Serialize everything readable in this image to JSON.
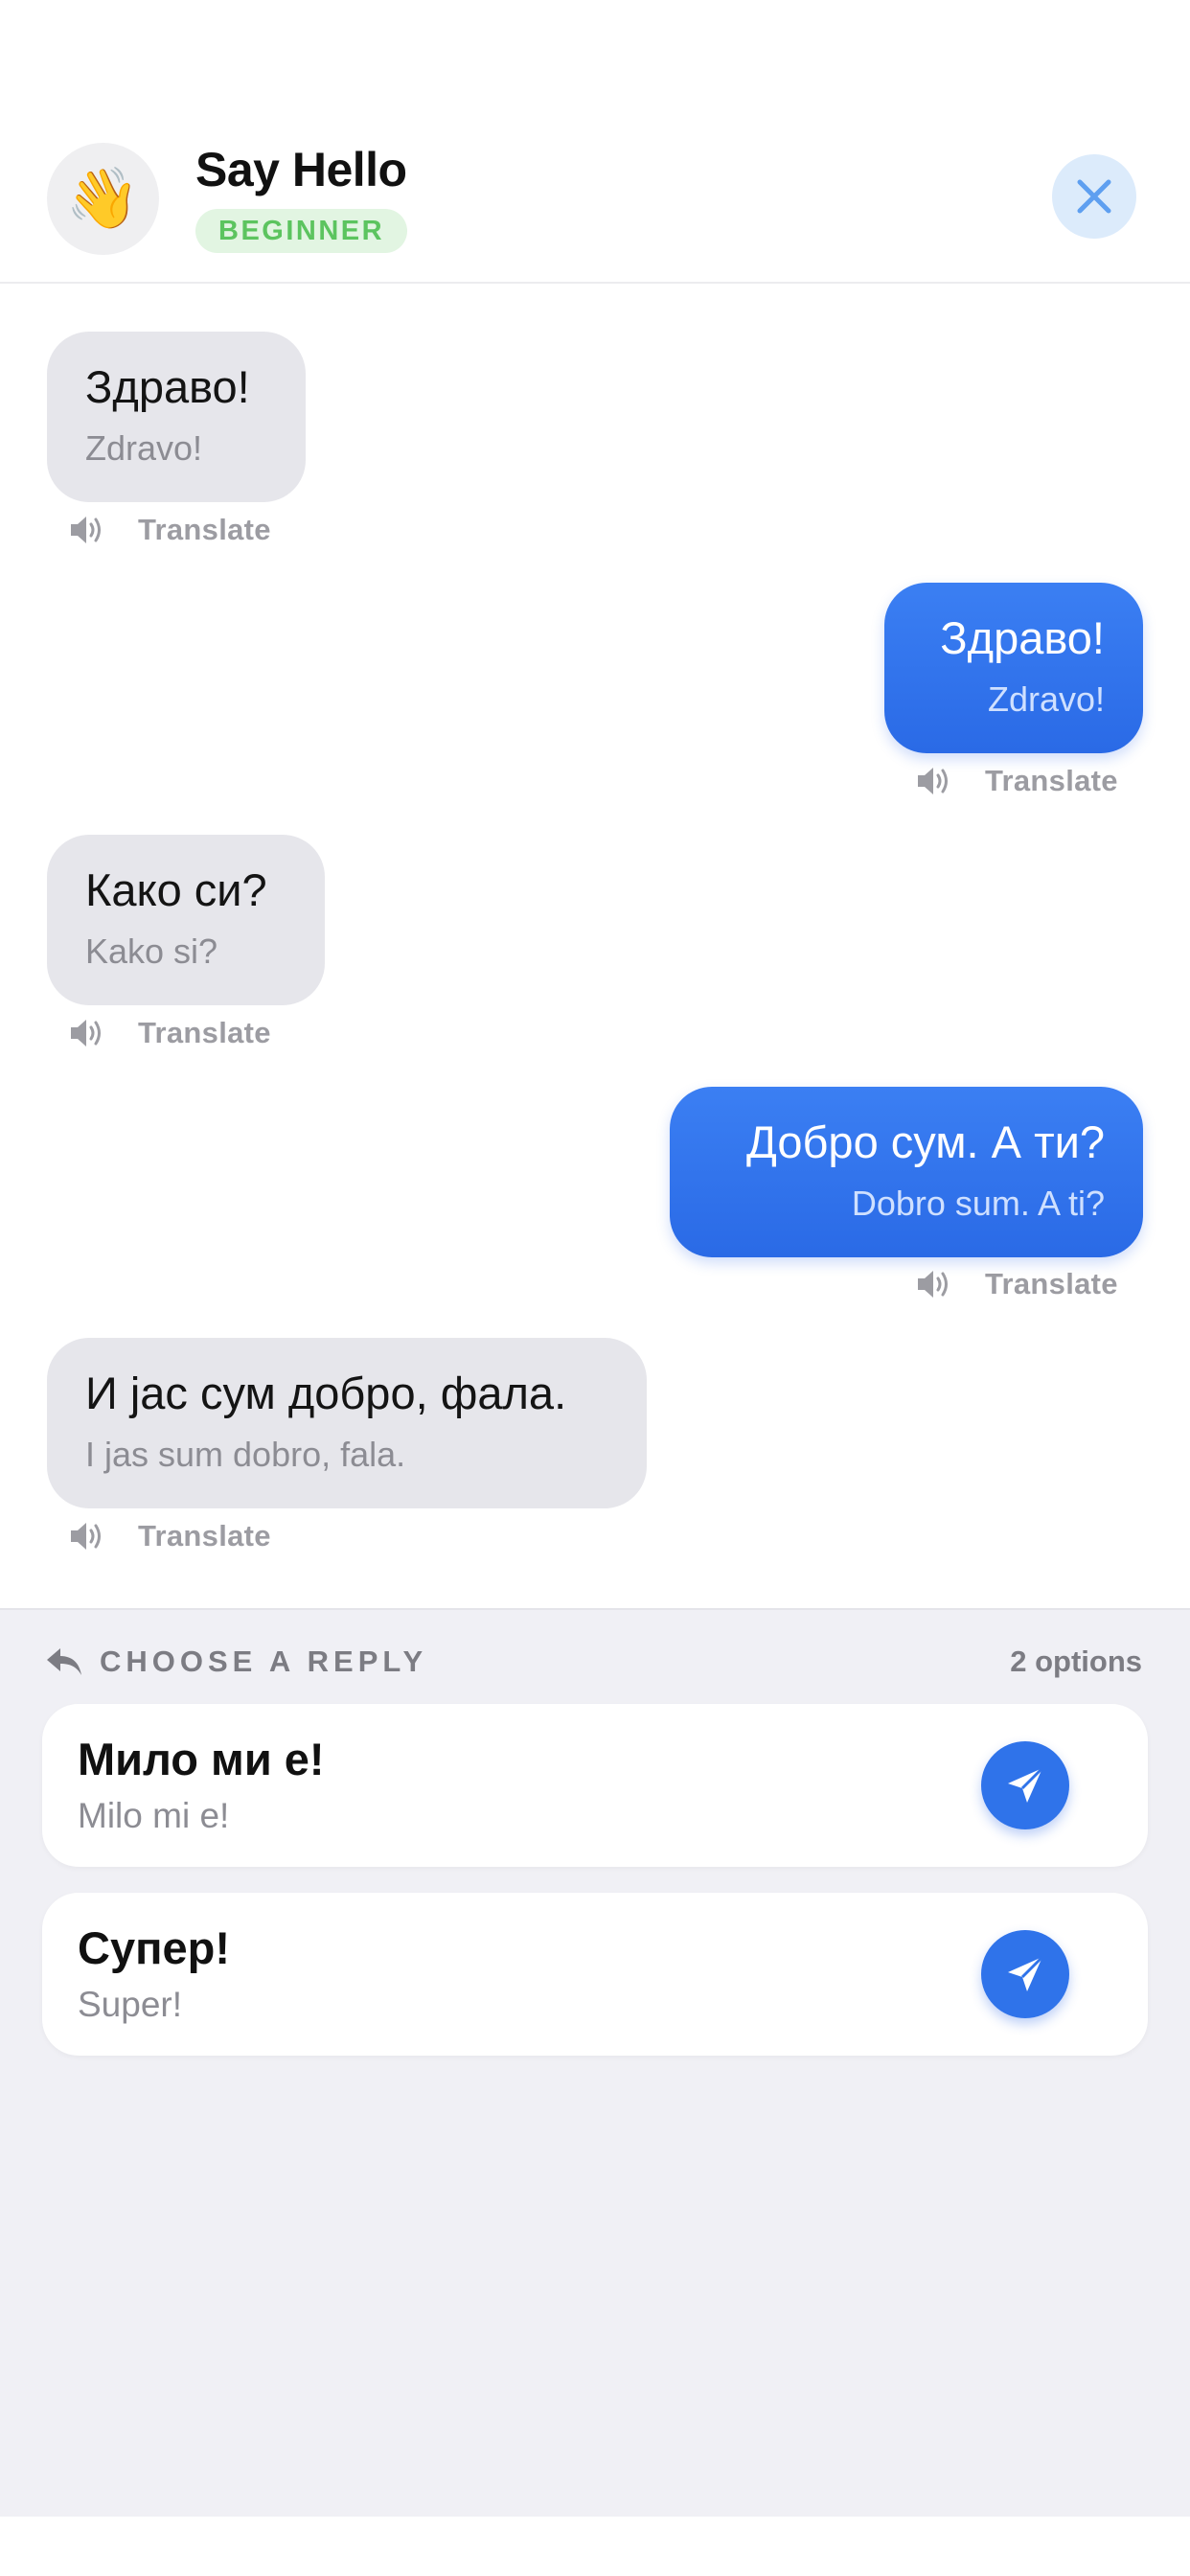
{
  "header": {
    "avatar_emoji": "👋",
    "title": "Say Hello",
    "level": "BEGINNER"
  },
  "messages": [
    {
      "side": "in",
      "text": "Здраво!",
      "translit": "Zdravo!",
      "action_label": "Translate"
    },
    {
      "side": "out",
      "text": "Здраво!",
      "translit": "Zdravo!",
      "action_label": "Translate"
    },
    {
      "side": "in",
      "text": "Како си?",
      "translit": "Kako si?",
      "action_label": "Translate"
    },
    {
      "side": "out",
      "text": "Добро сум. А ти?",
      "translit": "Dobro sum. A ti?",
      "action_label": "Translate"
    },
    {
      "side": "in",
      "text": "И јас сум добро, фала.",
      "translit": "I jas sum dobro, fala.",
      "action_label": "Translate"
    }
  ],
  "reply_panel": {
    "label": "CHOOSE A REPLY",
    "count": "2 options",
    "options": [
      {
        "text": "Мило ми е!",
        "translit": "Milo mi e!"
      },
      {
        "text": "Супер!",
        "translit": "Super!"
      }
    ]
  },
  "colors": {
    "accent": "#2f73ea",
    "incoming_bubble": "#e6e6eb",
    "badge_text": "#5cc45f",
    "badge_bg": "#e2f5e2",
    "panel_bg": "#f0f0f5"
  },
  "icons": {
    "close": "close-icon",
    "speaker": "speaker-icon",
    "reply": "reply-arrow-icon",
    "send": "send-icon"
  }
}
